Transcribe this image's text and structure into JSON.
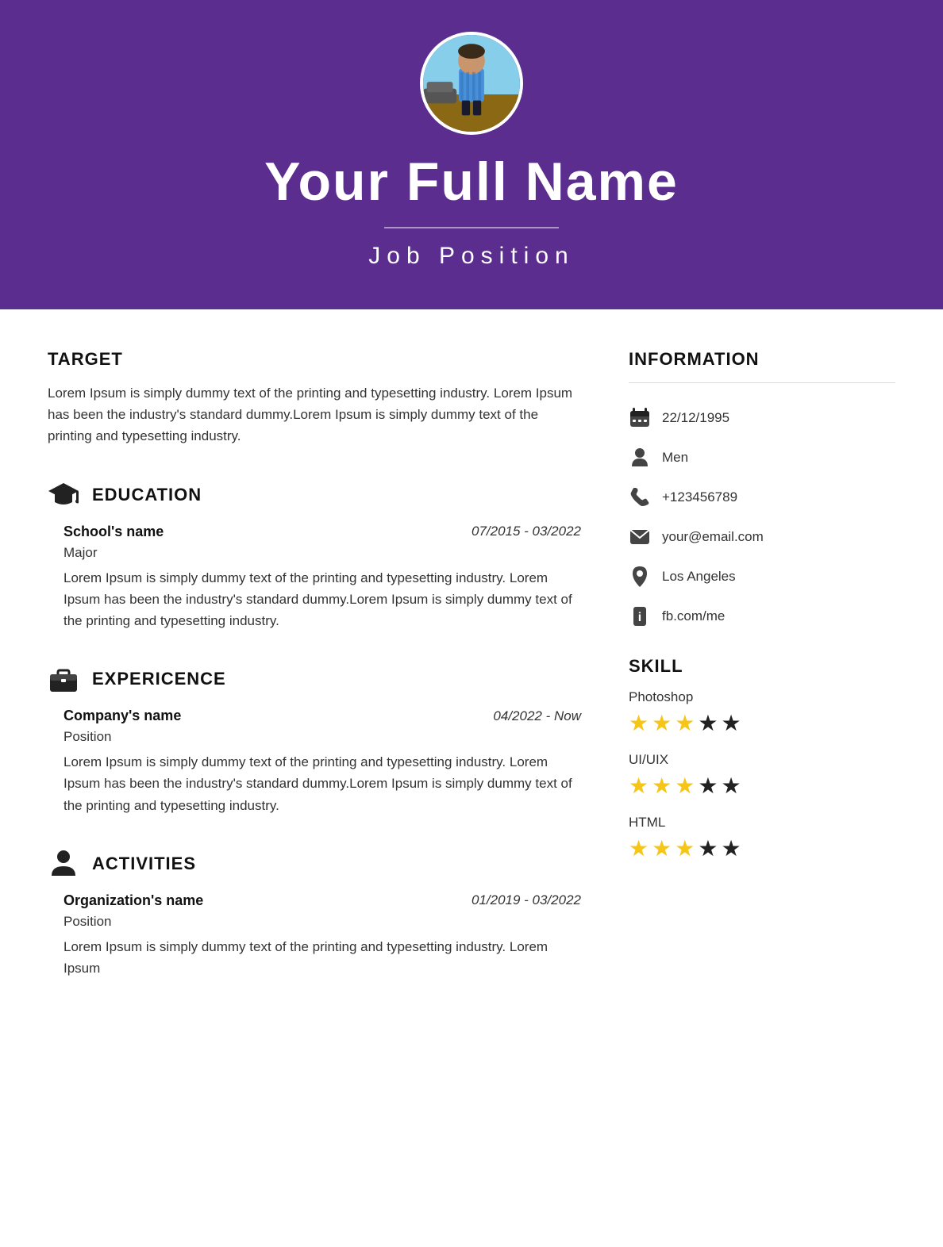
{
  "header": {
    "name": "Your Full Name",
    "position": "Job Position",
    "divider_visible": true
  },
  "target": {
    "title": "TARGET",
    "text": "Lorem Ipsum is simply dummy text of the printing and typesetting industry. Lorem Ipsum has been the industry's standard dummy.Lorem Ipsum is simply dummy text of the printing and typesetting industry."
  },
  "education": {
    "title": "EDUCATION",
    "icon": "graduation-cap-icon",
    "entries": [
      {
        "name": "School's name",
        "date": "07/2015 - 03/2022",
        "sub": "Major",
        "text": "Lorem Ipsum is simply dummy text of the printing and typesetting industry. Lorem Ipsum has been the industry's standard dummy.Lorem Ipsum is simply dummy text of the printing and typesetting industry."
      }
    ]
  },
  "experience": {
    "title": "EXPERICENCE",
    "icon": "briefcase-icon",
    "entries": [
      {
        "name": "Company's name",
        "date": "04/2022 - Now",
        "sub": "Position",
        "text": "Lorem Ipsum is simply dummy text of the printing and typesetting industry. Lorem Ipsum has been the industry's standard dummy.Lorem Ipsum is simply dummy text of the printing and typesetting industry."
      }
    ]
  },
  "activities": {
    "title": "ACTIVITIES",
    "icon": "person-icon",
    "entries": [
      {
        "name": "Organization's name",
        "date": "01/2019 - 03/2022",
        "sub": "Position",
        "text": "Lorem Ipsum is simply dummy text of the printing and typesetting industry. Lorem Ipsum"
      }
    ]
  },
  "information": {
    "title": "INFORMATION",
    "items": [
      {
        "icon": "calendar-icon",
        "value": "22/12/1995"
      },
      {
        "icon": "person-icon",
        "value": "Men"
      },
      {
        "icon": "phone-icon",
        "value": "+123456789"
      },
      {
        "icon": "email-icon",
        "value": "your@email.com"
      },
      {
        "icon": "location-icon",
        "value": "Los Angeles"
      },
      {
        "icon": "facebook-icon",
        "value": "fb.com/me"
      }
    ]
  },
  "skills": {
    "title": "SKILL",
    "items": [
      {
        "name": "Photoshop",
        "filled": 3,
        "empty": 2
      },
      {
        "name": "UI/UIX",
        "filled": 3,
        "empty": 2
      },
      {
        "name": "HTML",
        "filled": 3,
        "empty": 2
      }
    ]
  }
}
